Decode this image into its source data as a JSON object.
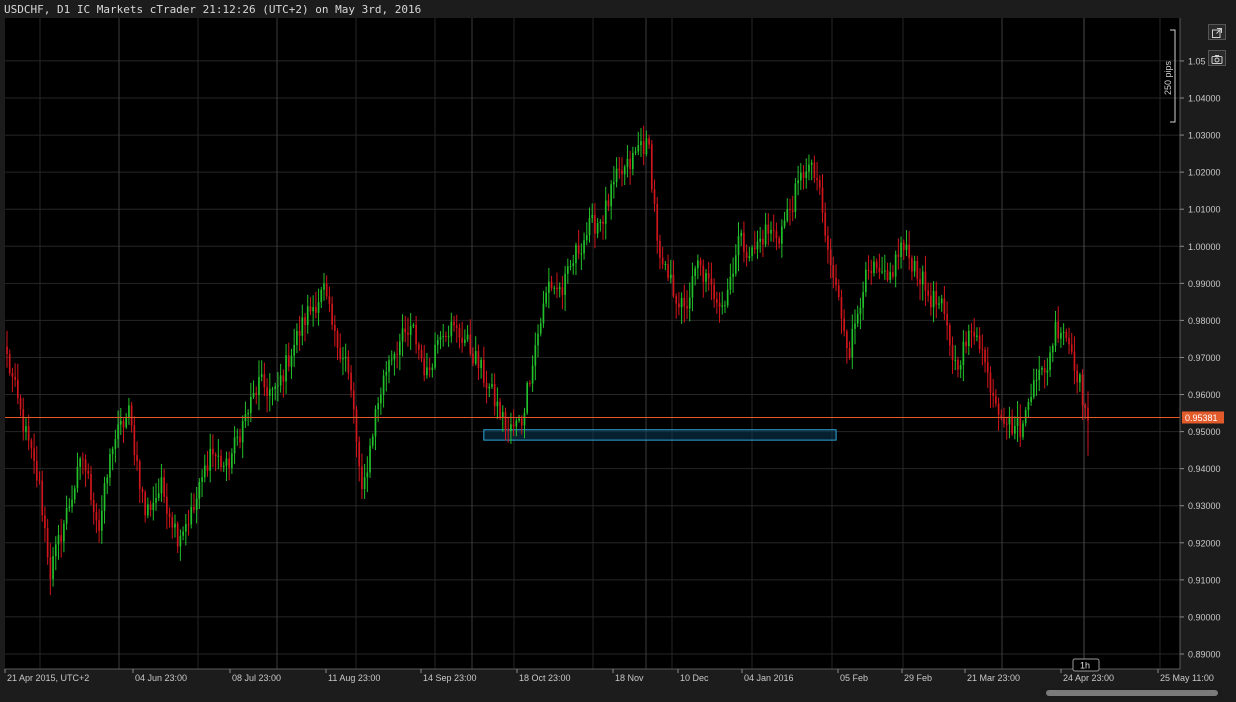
{
  "title": "USDCHF, D1 IC Markets cTrader 21:12:26 (UTC+2) on May 3rd, 2016",
  "icons": {
    "popout": "external-link-icon",
    "screenshot": "camera-icon"
  },
  "colors": {
    "background": "#000000",
    "frame": "#1c1c1c",
    "grid": "#262626",
    "bull": "#22c02a",
    "bear": "#d0161c",
    "price_line": "#e35a2b",
    "price_tag": "#e35a2b",
    "zone_border": "#2ea6d9",
    "zone_fill": "#0b3a55",
    "text": "#c8c8c8"
  },
  "chart_data": {
    "type": "candlestick",
    "symbol": "USDCHF",
    "timeframe": "D1",
    "ylim": [
      0.885,
      1.062
    ],
    "y_ticks": [
      "0.89000",
      "0.90000",
      "0.91000",
      "0.92000",
      "0.93000",
      "0.94000",
      "0.95000",
      "0.96000",
      "0.97000",
      "0.98000",
      "0.99000",
      "1.00000",
      "1.01000",
      "1.02000",
      "1.03000",
      "1.04000",
      "1.05"
    ],
    "x_tick_labels": [
      "21 Apr 2015, UTC+2",
      "04 Jun 23:00",
      "08 Jul 23:00",
      "11 Aug 23:00",
      "14 Sep 23:00",
      "18 Oct 23:00",
      "18 Nov",
      "10 Dec",
      "04 Jan 2016",
      "05 Feb",
      "29 Feb",
      "21 Mar 23:00",
      "24 Apr 23:00",
      "25 May 11:00"
    ],
    "current_price": "0.95381",
    "current_price_value": 0.95381,
    "pips_scale_label": "250 pips",
    "support_zone": {
      "low": 0.9477,
      "high": 0.9505,
      "from_index": 176,
      "to_index": 292
    },
    "hover_label": "1h",
    "key_points": [
      [
        0,
        0.97
      ],
      [
        6,
        0.952
      ],
      [
        12,
        0.935
      ],
      [
        16,
        0.912
      ],
      [
        22,
        0.928
      ],
      [
        28,
        0.943
      ],
      [
        34,
        0.924
      ],
      [
        39,
        0.947
      ],
      [
        45,
        0.955
      ],
      [
        51,
        0.928
      ],
      [
        57,
        0.935
      ],
      [
        63,
        0.922
      ],
      [
        69,
        0.929
      ],
      [
        75,
        0.945
      ],
      [
        81,
        0.94
      ],
      [
        87,
        0.952
      ],
      [
        93,
        0.963
      ],
      [
        99,
        0.96
      ],
      [
        105,
        0.972
      ],
      [
        111,
        0.982
      ],
      [
        117,
        0.988
      ],
      [
        121,
        0.975
      ],
      [
        125,
        0.97
      ],
      [
        128,
        0.955
      ],
      [
        131,
        0.932
      ],
      [
        136,
        0.955
      ],
      [
        141,
        0.97
      ],
      [
        146,
        0.975
      ],
      [
        150,
        0.977
      ],
      [
        155,
        0.965
      ],
      [
        160,
        0.978
      ],
      [
        164,
        0.978
      ],
      [
        169,
        0.975
      ],
      [
        174,
        0.968
      ],
      [
        179,
        0.96
      ],
      [
        185,
        0.95
      ],
      [
        190,
        0.953
      ],
      [
        194,
        0.97
      ],
      [
        200,
        0.99
      ],
      [
        205,
        0.988
      ],
      [
        210,
        0.998
      ],
      [
        215,
        1.005
      ],
      [
        220,
        1.008
      ],
      [
        225,
        1.018
      ],
      [
        230,
        1.022
      ],
      [
        234,
        1.028
      ],
      [
        237,
        1.026
      ],
      [
        241,
        0.995
      ],
      [
        245,
        0.99
      ],
      [
        250,
        0.982
      ],
      [
        255,
        0.995
      ],
      [
        260,
        0.988
      ],
      [
        265,
        0.985
      ],
      [
        270,
        1.002
      ],
      [
        275,
        0.998
      ],
      [
        280,
        1.004
      ],
      [
        285,
        1.003
      ],
      [
        290,
        1.012
      ],
      [
        295,
        1.022
      ],
      [
        299,
        1.018
      ],
      [
        303,
        0.998
      ],
      [
        307,
        0.985
      ],
      [
        311,
        0.972
      ],
      [
        316,
        0.99
      ],
      [
        320,
        0.993
      ],
      [
        325,
        0.99
      ],
      [
        330,
        1.0
      ],
      [
        335,
        0.995
      ],
      [
        340,
        0.987
      ],
      [
        345,
        0.983
      ],
      [
        350,
        0.968
      ],
      [
        355,
        0.975
      ],
      [
        358,
        0.978
      ],
      [
        362,
        0.965
      ],
      [
        366,
        0.957
      ],
      [
        370,
        0.952
      ],
      [
        375,
        0.951
      ],
      [
        379,
        0.966
      ],
      [
        383,
        0.965
      ],
      [
        387,
        0.978
      ],
      [
        390,
        0.978
      ],
      [
        393,
        0.972
      ],
      [
        396,
        0.963
      ],
      [
        399,
        0.953
      ]
    ]
  }
}
